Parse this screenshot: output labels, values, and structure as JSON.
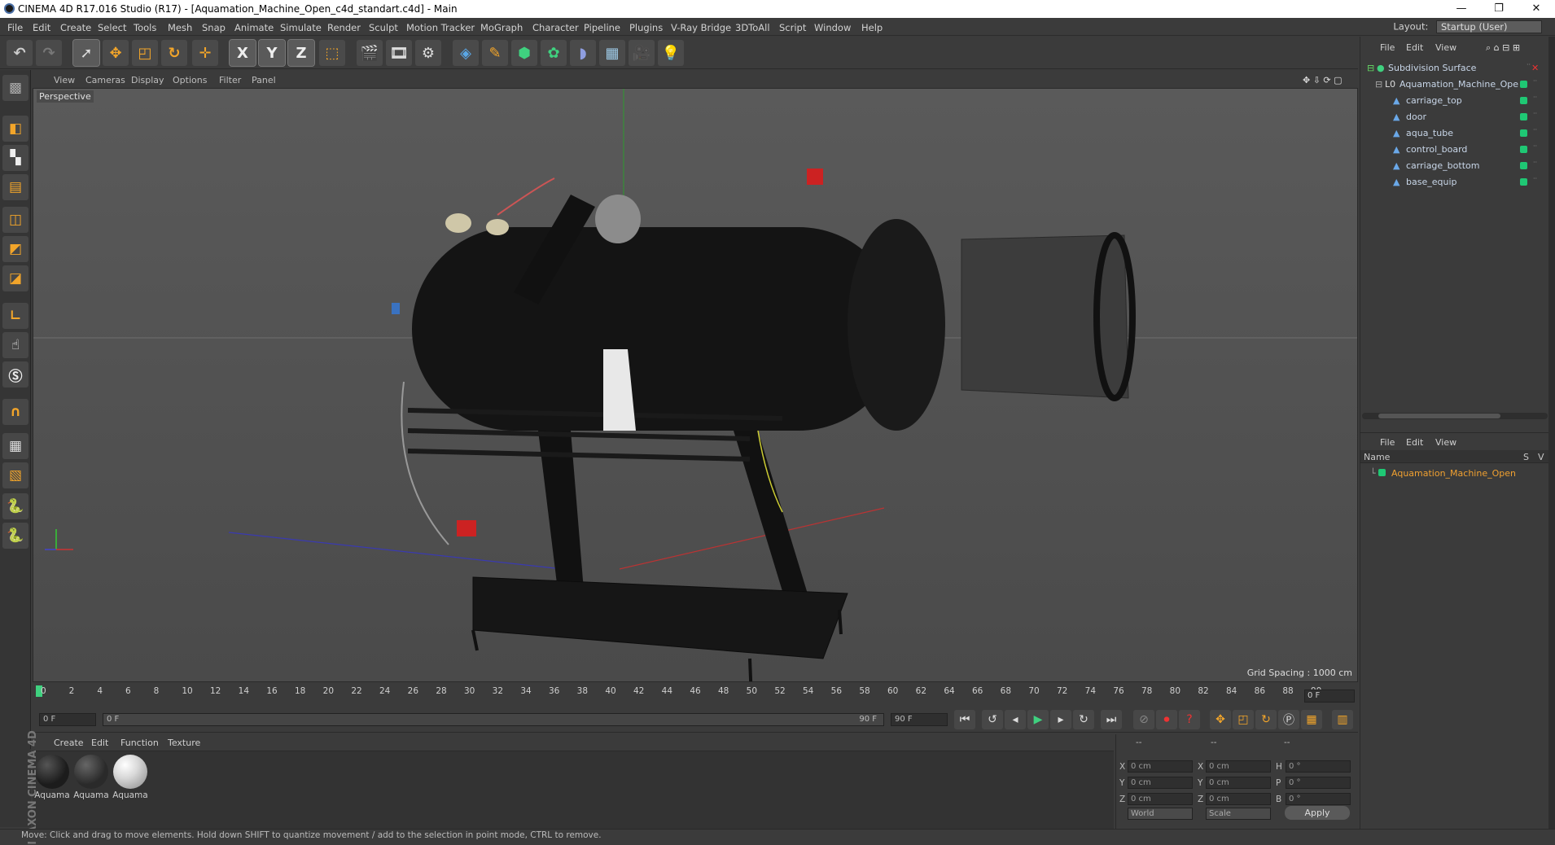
{
  "window": {
    "title": "CINEMA 4D R17.016 Studio (R17) - [Aquamation_Machine_Open_c4d_standart.c4d] - Main",
    "buttons": [
      "—",
      "❐",
      "✕"
    ]
  },
  "menu": [
    "File",
    "Edit",
    "Create",
    "Select",
    "Tools",
    "Mesh",
    "Snap",
    "Animate",
    "Simulate",
    "Render",
    "Sculpt",
    "Motion Tracker",
    "MoGraph",
    "Character",
    "Pipeline",
    "Plugins",
    "V-Ray Bridge",
    "3DToAll",
    "Script",
    "Window",
    "Help"
  ],
  "layout": {
    "label": "Layout:",
    "value": "Startup (User)"
  },
  "toolbar": {
    "items": [
      "undo-icon",
      "redo-icon",
      "select-arrow-icon",
      "move-icon",
      "scale-icon",
      "rotate-icon",
      "transform-icon",
      "x-axis-icon",
      "y-axis-icon",
      "z-axis-icon",
      "world-coord-icon",
      "render-view-icon",
      "render-region-icon",
      "render-settings-icon",
      "cube-icon",
      "pen-icon",
      "subdivision-icon",
      "cloner-icon",
      "deformer-icon",
      "floor-icon",
      "camera-icon",
      "light-icon"
    ],
    "axis_labels": [
      "X",
      "Y",
      "Z"
    ]
  },
  "viewport": {
    "menu": [
      "View",
      "Cameras",
      "Display",
      "Options",
      "Filter",
      "Panel"
    ],
    "label": "Perspective",
    "grid_spacing": "Grid Spacing : 1000 cm"
  },
  "timeline": {
    "ticks": [
      "0",
      "2",
      "4",
      "6",
      "8",
      "10",
      "12",
      "14",
      "16",
      "18",
      "20",
      "22",
      "24",
      "26",
      "28",
      "30",
      "32",
      "34",
      "36",
      "38",
      "40",
      "42",
      "44",
      "46",
      "48",
      "50",
      "52",
      "54",
      "56",
      "58",
      "60",
      "62",
      "64",
      "66",
      "68",
      "70",
      "72",
      "74",
      "76",
      "78",
      "80",
      "82",
      "84",
      "86",
      "88",
      "90"
    ],
    "current_frame": "0 F"
  },
  "transport": {
    "start": "0 F",
    "range_start": "0 F",
    "range_end": "90 F",
    "end": "90 F"
  },
  "materials": {
    "menu": [
      "Create",
      "Edit",
      "Function",
      "Texture"
    ],
    "items": [
      {
        "name": "Aquama",
        "color": "#1c1c1c"
      },
      {
        "name": "Aquama",
        "color": "#2a2a2a"
      },
      {
        "name": "Aquama",
        "color": "#d8d8d8"
      }
    ]
  },
  "coordinates": {
    "header": [
      "--",
      "--",
      "--"
    ],
    "rows": [
      {
        "a": "X",
        "av": "0 cm",
        "b": "X",
        "bv": "0 cm",
        "c": "H",
        "cv": "0 °"
      },
      {
        "a": "Y",
        "av": "0 cm",
        "b": "Y",
        "bv": "0 cm",
        "c": "P",
        "cv": "0 °"
      },
      {
        "a": "Z",
        "av": "0 cm",
        "b": "Z",
        "bv": "0 cm",
        "c": "B",
        "cv": "0 °"
      }
    ],
    "mode1": "World",
    "mode2": "Scale",
    "apply": "Apply"
  },
  "objects": {
    "menu": [
      "File",
      "Edit",
      "View"
    ],
    "tree": [
      {
        "name": "Subdivision Surface",
        "level": 0
      },
      {
        "name": "Aquamation_Machine_Ope",
        "level": 1
      },
      {
        "name": "carriage_top",
        "level": 2
      },
      {
        "name": "door",
        "level": 2
      },
      {
        "name": "aqua_tube",
        "level": 2
      },
      {
        "name": "control_board",
        "level": 2
      },
      {
        "name": "carriage_bottom",
        "level": 2
      },
      {
        "name": "base_equip",
        "level": 2
      }
    ]
  },
  "layers": {
    "menu": [
      "File",
      "Edit",
      "View"
    ],
    "columns": {
      "name": "Name",
      "s": "S",
      "v": "V"
    },
    "item": "Aquamation_Machine_Open",
    "item_color": "#f0a030"
  },
  "statusbar": "Move: Click and drag to move elements. Hold down SHIFT to quantize movement / add to the selection in point mode, CTRL to remove.",
  "brand": "MAXON CINEMA 4D"
}
